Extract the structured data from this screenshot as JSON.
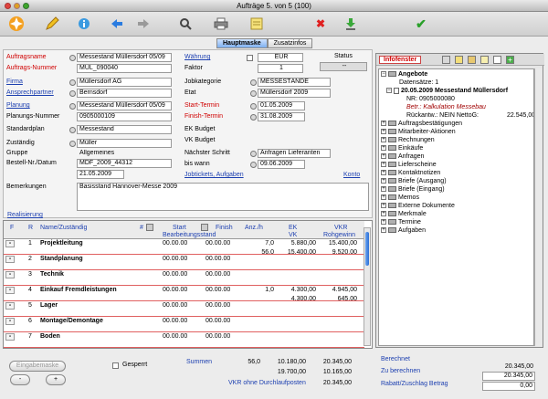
{
  "window": {
    "title": "Aufträge 5. von 5 (100)"
  },
  "colors": {
    "accent": "#1c3fb0",
    "required": "#d00000",
    "selection": "#7fb0f0"
  },
  "toolbar": {
    "icons": [
      "logo-icon",
      "pencil-icon",
      "info-icon",
      "arrow-left-icon",
      "arrow-right-icon",
      "search-icon",
      "printer-icon",
      "notes-icon",
      "delete-icon",
      "download-icon",
      "checkmark-icon"
    ]
  },
  "tabs": [
    "Hauptmaske",
    "Zusatzinfos"
  ],
  "form": {
    "auftragsname": {
      "label": "Auftragsname",
      "value": "Messestand Müllersdorf 05/09"
    },
    "auftragsnummer": {
      "label": "Auftrags-Nummer",
      "value": "MÜL_090040"
    },
    "firma": {
      "label": "Firma",
      "value": "Müllersdorf AG"
    },
    "ansprechpartner": {
      "label": "Ansprechpartner",
      "value": "Bernsdorf"
    },
    "planung": {
      "label": "Planung",
      "value": "Messestand Müllersdorf 05/09"
    },
    "planungsnummer": {
      "label": "Planungs-Nummer",
      "value": "0905000109"
    },
    "standardplan": {
      "label": "Standardplan",
      "value": "Messestand"
    },
    "zustaendig": {
      "label": "Zuständig",
      "value": "Müller"
    },
    "gruppe": {
      "label": "Gruppe",
      "value": "Allgemeines"
    },
    "bestellnr": {
      "label": "Bestell-Nr./Datum",
      "value": "MDF_2009_44312",
      "date": "21.05.2009"
    },
    "waehrung": {
      "label": "Währung",
      "value": "EUR"
    },
    "faktor": {
      "label": "Faktor",
      "value": "1"
    },
    "status": {
      "label": "Status",
      "value": "--"
    },
    "jobkategorie": {
      "label": "Jobkategorie",
      "value": "MESSESTÄNDE"
    },
    "etat": {
      "label": "Etat",
      "value": "Müllersdorf 2009"
    },
    "starttermin": {
      "label": "Start-Termin",
      "value": "01.05.2009"
    },
    "finishtermin": {
      "label": "Finish-Termin",
      "value": "31.08.2009"
    },
    "ekbudget": {
      "label": "EK Budget",
      "value": ""
    },
    "vkbudget": {
      "label": "VK Budget",
      "value": ""
    },
    "naechsterschritt": {
      "label": "Nächster Schritt",
      "value": "Anfragen Lieferanten"
    },
    "biswann": {
      "label": "bis wann",
      "value": "09.06.2009"
    },
    "links": {
      "jobtickets": "Jobtickets, Aufgaben",
      "konto": "Konto"
    },
    "bemerkungen": {
      "label": "Bemerkungen",
      "value": "Basisstand Hannover-Messe 2009"
    },
    "realisierung": "Realisierung"
  },
  "grid": {
    "headers": {
      "f": "F",
      "r": "R",
      "name": "Name/Zuständig",
      "hash": "#",
      "start": "Start",
      "finish": "Finish",
      "bearb": "Bearbeitungsstand",
      "anz": "Anz./h",
      "ek": "EK",
      "vk": "VK",
      "vkr": "VKR",
      "rohgewinn": "Rohgewinn"
    },
    "rows": [
      {
        "btn": "-",
        "nr": "1",
        "name": "Projektleitung",
        "start": "00.00.00",
        "finish": "00.00.00",
        "anz": "7,0",
        "ek": "5.880,00",
        "vkr": "15.400,00",
        "sub": {
          "anz": "56,0",
          "vk": "15.400,00",
          "roh": "9.520,00"
        }
      },
      {
        "btn": "-",
        "nr": "2",
        "name": "Standplanung",
        "start": "00.00.00",
        "finish": "00.00.00",
        "anz": "",
        "ek": "",
        "vkr": "",
        "sub": null
      },
      {
        "btn": "-",
        "nr": "3",
        "name": "Technik",
        "start": "00.00.00",
        "finish": "00.00.00",
        "anz": "",
        "ek": "",
        "vkr": "",
        "sub": null
      },
      {
        "btn": "-",
        "nr": "4",
        "name": "Einkauf Fremdleistungen",
        "start": "00.00.00",
        "finish": "00.00.00",
        "anz": "1,0",
        "ek": "4.300,00",
        "vkr": "4.945,00",
        "sub": {
          "anz": "",
          "vk": "4.300,00",
          "roh": "645,00"
        }
      },
      {
        "btn": "-",
        "nr": "5",
        "name": "Lager",
        "start": "00.00.00",
        "finish": "00.00.00",
        "anz": "",
        "ek": "",
        "vkr": "",
        "sub": null
      },
      {
        "btn": "-",
        "nr": "6",
        "name": "Montage/Demontage",
        "start": "00.00.00",
        "finish": "00.00.00",
        "anz": "",
        "ek": "",
        "vkr": "",
        "sub": null
      },
      {
        "btn": "-",
        "nr": "7",
        "name": "Boden",
        "start": "00.00.00",
        "finish": "00.00.00",
        "anz": "",
        "ek": "",
        "vkr": "",
        "sub": null
      }
    ]
  },
  "infopanel": {
    "button": "Infofenster",
    "tree": [
      {
        "kind": "open",
        "label": "Angebote",
        "bold": true
      },
      {
        "kind": "sub",
        "label": "Datensätze: 1"
      },
      {
        "kind": "doc",
        "label": "20.05.2009 Messestand Müllersdorf",
        "bold": true
      },
      {
        "kind": "sub2",
        "label": "NR: 0905000080"
      },
      {
        "kind": "sub2i",
        "label": "Betr.: Kalkulation Messebau"
      },
      {
        "kind": "sub2r",
        "label": "Rückantw.: NEIN NettoG:",
        "value": "22.545,00"
      },
      {
        "kind": "folder",
        "label": "Auftragsbestätigungen"
      },
      {
        "kind": "folder",
        "label": "Mitarbeiter-Aktionen"
      },
      {
        "kind": "folder",
        "label": "Rechnungen"
      },
      {
        "kind": "folder",
        "label": "Einkäufe"
      },
      {
        "kind": "folder",
        "label": "Anfragen"
      },
      {
        "kind": "folder",
        "label": "Lieferscheine"
      },
      {
        "kind": "folder",
        "label": "Kontaktnotizen"
      },
      {
        "kind": "folder",
        "label": "Briefe (Ausgang)"
      },
      {
        "kind": "folder",
        "label": "Briefe (Eingang)"
      },
      {
        "kind": "folder",
        "label": "Memos"
      },
      {
        "kind": "folder",
        "label": "Externe Dokumente"
      },
      {
        "kind": "folder",
        "label": "Merkmale"
      },
      {
        "kind": "folder",
        "label": "Termine"
      },
      {
        "kind": "folder",
        "label": "Aufgaben"
      }
    ]
  },
  "bottom": {
    "eingabemaske": "Eingabemaske",
    "minus": "-",
    "plus": "+",
    "gesperrt": "Gesperrt",
    "summen_label": "Summen",
    "summen": [
      "56,0",
      "10.180,00",
      "20.345,00"
    ],
    "row2": [
      "19.700,00",
      "10.165,00"
    ],
    "vkr_label": "VKR ohne Durchlaufposten",
    "vkr_value": "20.345,00",
    "berechnet_label": "Berechnet",
    "berechnet": "20.345,00",
    "zuberechnen_label": "Zu berechnen",
    "zuberechnen": "20.345,00",
    "rabatt_label": "Rabatt/Zuschlag Betrag",
    "rabatt": "0,00"
  }
}
